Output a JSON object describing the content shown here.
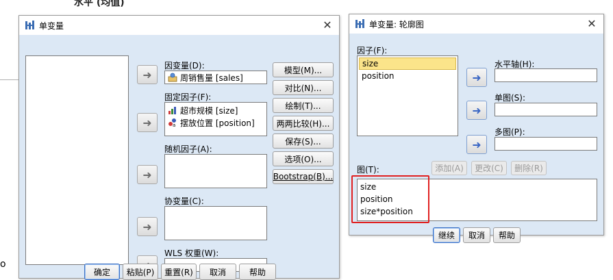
{
  "background": {
    "top_text": "水平 (均值)",
    "bottom_char": "o"
  },
  "univariate": {
    "title": "单变量",
    "dependent_label": "因变量(D):",
    "dependent_value": "周销售量 [sales]",
    "fixed_label": "固定因子(F):",
    "fixed_items": [
      "超市规模 [size]",
      "摆放位置 [position]"
    ],
    "random_label": "随机因子(A):",
    "covariate_label": "协变量(C):",
    "wls_label": "WLS 权重(W):",
    "side_buttons": [
      "模型(M)...",
      "对比(N)...",
      "绘制(T)...",
      "两两比较(H)...",
      "保存(S)...",
      "选项(O)...",
      "Bootstrap(B)..."
    ],
    "bottom_buttons": [
      "确定",
      "粘贴(P)",
      "重置(R)",
      "取消",
      "帮助"
    ]
  },
  "profile": {
    "title": "单变量: 轮廓图",
    "factors_label": "因子(F):",
    "factors": [
      "size",
      "position"
    ],
    "horizontal_label": "水平轴(H):",
    "separate_lines_label": "单图(S):",
    "separate_plots_label": "多图(P):",
    "plots_label": "图(T):",
    "action_buttons": [
      "添加(A)",
      "更改(C)",
      "删除(R)"
    ],
    "plots": [
      "size",
      "position",
      "size*position"
    ],
    "bottom_buttons": [
      "继续",
      "取消",
      "帮助"
    ]
  }
}
